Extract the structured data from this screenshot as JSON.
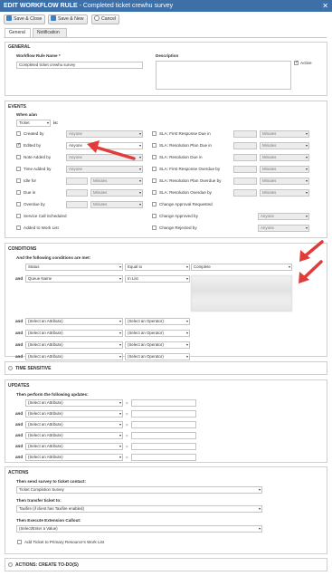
{
  "window": {
    "title": "EDIT WORKFLOW RULE",
    "subtitle": " - Completed ticket crewhu survey",
    "close_glyph": "✕"
  },
  "toolbar": {
    "save_close": "Save & Close",
    "save_new": "Save & New",
    "cancel": "Cancel"
  },
  "tabs": [
    "General",
    "Notification"
  ],
  "general": {
    "heading": "GENERAL",
    "rule_name_label": "Workflow Rule Name *",
    "rule_name_value": "Completed ticket crewhu survey",
    "description_label": "Description",
    "active_label": "Active"
  },
  "events": {
    "heading": "EVENTS",
    "when_label": "When a/an",
    "entity_value": "Ticket",
    "is_label": "is:",
    "left": [
      {
        "label": "Created by",
        "value": "Anyone",
        "checked": false
      },
      {
        "label": "Edited by",
        "value": "Anyone",
        "checked": true
      },
      {
        "label": "Note Added by",
        "value": "Anyone",
        "checked": false
      },
      {
        "label": "Time Added by",
        "value": "Anyone",
        "checked": false
      },
      {
        "label": "Idle for",
        "value": "Minutes",
        "checked": false
      },
      {
        "label": "Due in",
        "value": "Minutes",
        "checked": false
      },
      {
        "label": "Overdue by",
        "value": "Minutes",
        "checked": false
      },
      {
        "label": "Service Call Scheduled",
        "value": "",
        "checked": false
      },
      {
        "label": "Added to Work List",
        "value": "",
        "checked": false
      }
    ],
    "right": [
      {
        "label": "SLA: First Response Due in",
        "value": "Minutes"
      },
      {
        "label": "SLA: Resolution Plan Due in",
        "value": "Minutes"
      },
      {
        "label": "SLA: Resolution Due in",
        "value": "Minutes"
      },
      {
        "label": "SLA: First Response Overdue by",
        "value": "Minutes"
      },
      {
        "label": "SLA: Resolution Plan Overdue by",
        "value": "Minutes"
      },
      {
        "label": "SLA: Resolution Overdue by",
        "value": "Minutes"
      },
      {
        "label": "Change Approval Requested",
        "value": ""
      },
      {
        "label": "Change Approved by",
        "value": "Anyone"
      },
      {
        "label": "Change Rejected by",
        "value": "Anyone"
      }
    ]
  },
  "conditions": {
    "heading": "CONDITIONS",
    "intro": "And the following conditions are met:",
    "and_label": "and",
    "rows": [
      {
        "attribute": "Status",
        "operator": "Equal to",
        "value": "Complete"
      },
      {
        "attribute": "Queue Name",
        "operator": "In List",
        "value": ""
      },
      {
        "attribute": "(Select an Attribute)",
        "operator": "(Select an Operator)",
        "value": ""
      },
      {
        "attribute": "(Select an Attribute)",
        "operator": "(Select an Operator)",
        "value": ""
      },
      {
        "attribute": "(Select an Attribute)",
        "operator": "(Select an Operator)",
        "value": ""
      },
      {
        "attribute": "(Select an Attribute)",
        "operator": "(Select an Operator)",
        "value": ""
      }
    ]
  },
  "time_sensitive": {
    "heading": "TIME SENSITIVE"
  },
  "updates": {
    "heading": "UPDATES",
    "intro": "Then perform the following updates:",
    "and_label": "and",
    "equals": "=",
    "rows": [
      "(Select an Attribute)",
      "(Select an Attribute)",
      "(Select an Attribute)",
      "(Select an Attribute)",
      "(Select an Attribute)",
      "(Select an Attribute)"
    ]
  },
  "actions": {
    "heading": "ACTIONS",
    "survey_label": "Then send survey to ticket contact:",
    "survey_value": "Ticket Completion Survey",
    "transfer_label": "Then transfer ticket to:",
    "transfer_value": "Taxifire (if client has Taxifire enabled)",
    "extension_label": "Then Execute Extension Callout:",
    "extension_value": "(Select/Enter a Value)",
    "primary_label": "Add Ticket to Primary Resource's Work List"
  },
  "actions_todo": {
    "heading": "ACTIONS: CREATE TO-DO(S)"
  },
  "colors": {
    "titlebar": "#3d6fa9",
    "arrow": "#e23b3b"
  },
  "icons": [
    "save-icon",
    "save-new-icon",
    "cancel-icon",
    "dropdown-arrow-icon",
    "checkbox-icon",
    "close-icon"
  ]
}
